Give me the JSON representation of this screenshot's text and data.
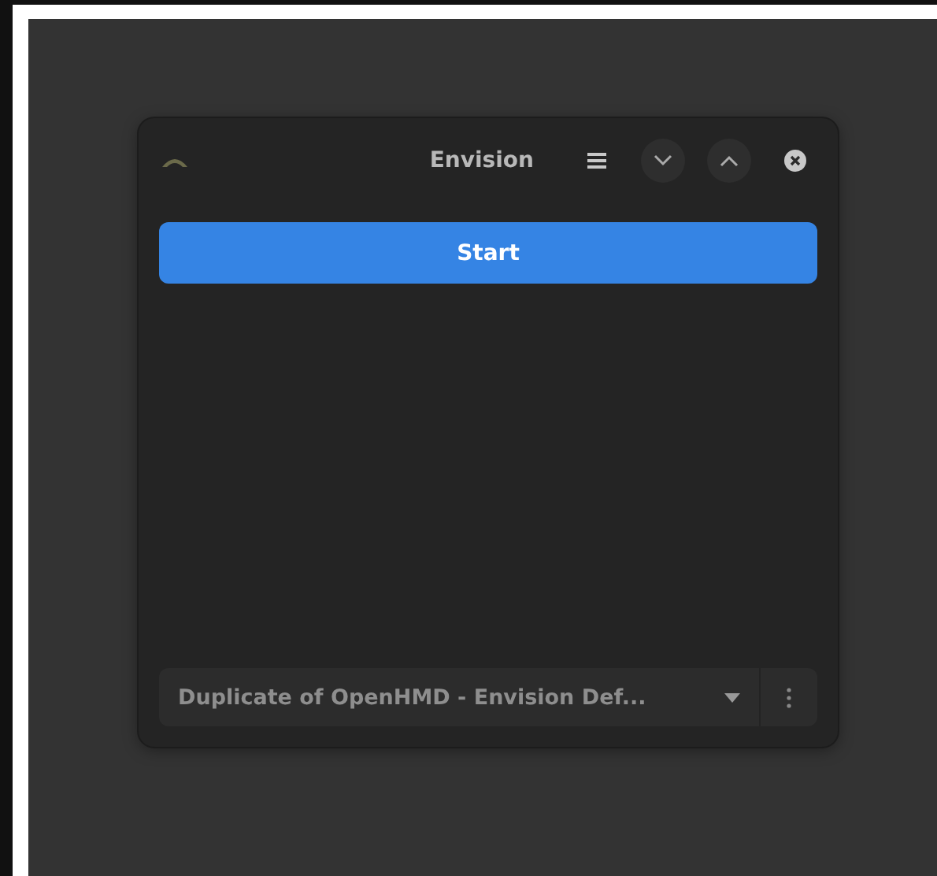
{
  "window": {
    "title": "Envision"
  },
  "start_button": {
    "label": "Start"
  },
  "profile_dropdown": {
    "value": "Duplicate of OpenHMD - Envision Def..."
  }
}
